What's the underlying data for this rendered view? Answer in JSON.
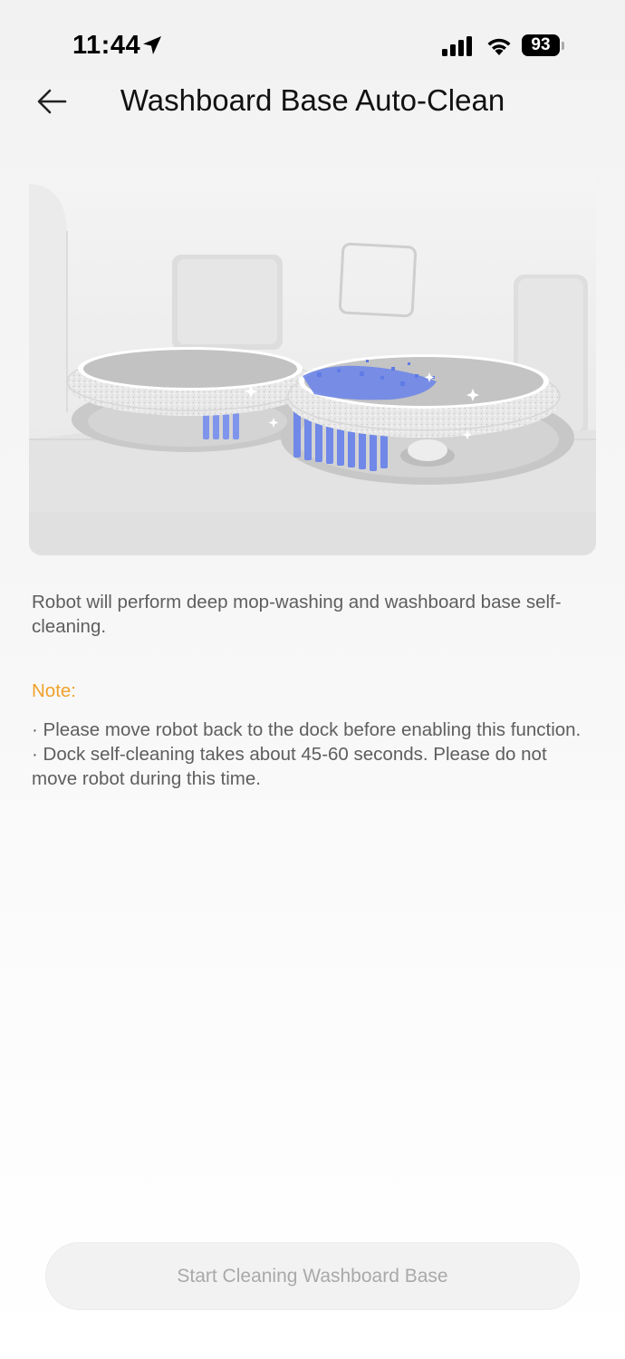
{
  "status_bar": {
    "time": "11:44",
    "battery": "93",
    "icons": [
      "location-arrow-icon",
      "cellular-signal-icon",
      "wifi-icon",
      "battery-icon"
    ]
  },
  "header": {
    "back_icon": "arrow-left-icon",
    "title": "Washboard Base Auto-Clean"
  },
  "illustration": {
    "subject": "robot-mop-dock-illustration",
    "accent_color": "#6f86e8"
  },
  "content": {
    "description": "Robot will perform deep mop-washing and washboard base self-cleaning.",
    "note_label": "Note:",
    "notes": [
      "· Please move robot back to the dock before enabling this function.",
      "· Dock self-cleaning takes about 45-60 seconds. Please do not move robot during this time."
    ]
  },
  "footer": {
    "start_button_label": "Start Cleaning Washboard Base",
    "start_button_state": "disabled"
  },
  "colors": {
    "note_accent": "#f0a12a",
    "body_text": "#5e5e5e",
    "disabled_button_text": "#a9a9a9"
  }
}
